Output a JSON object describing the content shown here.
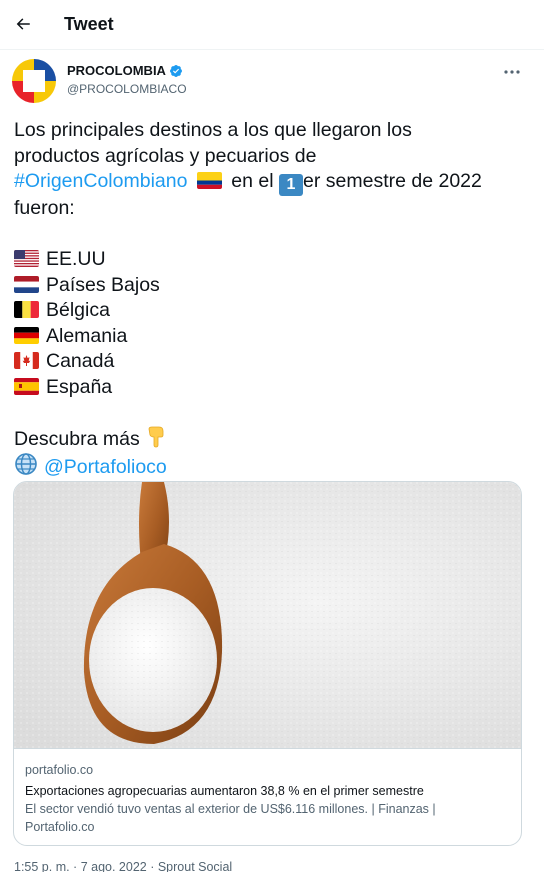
{
  "header": {
    "title": "Tweet"
  },
  "author": {
    "name": "PROCOLOMBIA",
    "handle": "@PROCOLOMBIACO"
  },
  "tweet": {
    "intro_1": "Los principales destinos a los que llegaron los",
    "intro_2": "productos agrícolas y pecuarios de",
    "hashtag": "#OrigenColombiano",
    "intro_3a": "en el",
    "keycap": "1",
    "intro_3b": "er semestre de 2022",
    "intro_4": "fueron:",
    "countries": [
      "EE.UU",
      "Países Bajos",
      "Bélgica",
      "Alemania",
      "Canadá",
      "España"
    ],
    "cta": "Descubra más",
    "mention": "@Portafolioco"
  },
  "card": {
    "domain": "portafolio.co",
    "title": "Exportaciones agropecuarias aumentaron 38,8 % en el primer semestre",
    "desc_1": "El sector vendió tuvo ventas al exterior de US$6.116 millones. | Finanzas |",
    "desc_2": "Portafolio.co"
  },
  "meta": {
    "line": "1:55 p. m. · 7 ago. 2022 · Sprout Social"
  },
  "colors": {
    "link": "#1d9bf0",
    "verified": "#1d9bf0",
    "text": "#0f1419",
    "muted": "#536471",
    "border": "#cfd9de"
  }
}
